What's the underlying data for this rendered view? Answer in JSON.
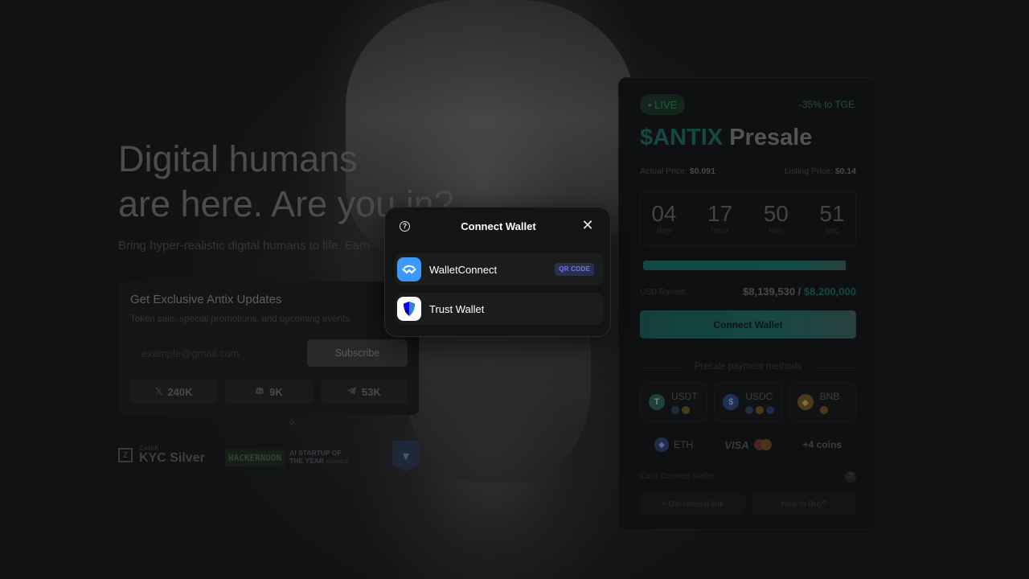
{
  "hero": {
    "title_line1": "Digital humans",
    "title_line2": "are here. Are you in?",
    "subtitle": "Bring hyper-realistic digital humans to life. Earn"
  },
  "updates": {
    "title": "Get Exclusive Antix Updates",
    "description": "Token sale, special promotions, and upcoming events",
    "email_placeholder": "example@gmail.com",
    "subscribe_label": "Subscribe",
    "socials": [
      {
        "icon": "x-icon",
        "count": "240K"
      },
      {
        "icon": "discord-icon",
        "count": "9K"
      },
      {
        "icon": "telegram-icon",
        "count": "53K"
      }
    ]
  },
  "badges": {
    "certik_small": "CertiK",
    "certik_big": "KYC Silver",
    "hackernoon_logo": "HACKERNOON",
    "hackernoon_line1": "AI STARTUP OF",
    "hackernoon_line2": "THE YEAR",
    "hackernoon_tag": "NOMINEE"
  },
  "presale": {
    "live_label": "• LIVE",
    "tge_label": "-35% to TGE",
    "token": "$ANTIX",
    "title_rest": "Presale",
    "actual_price_label": "Actual Price:",
    "actual_price": "$0.091",
    "listing_price_label": "Listing Price:",
    "listing_price": "$0.14",
    "countdown": [
      {
        "value": "04",
        "label": "day"
      },
      {
        "value": "17",
        "label": "hour"
      },
      {
        "value": "50",
        "label": "min"
      },
      {
        "value": "51",
        "label": "sec"
      }
    ],
    "progress_fraction": 0.993,
    "raised_label": "USD Raised:",
    "raised_value": "$8,139,530 /",
    "raised_target": "$8,200,000",
    "connect_label": "Connect Wallet",
    "methods_title": "Presale payment methods",
    "methods": [
      {
        "name": "USDT",
        "icon": "usdt-icon",
        "color": "#2b5e50"
      },
      {
        "name": "USDC",
        "icon": "usdc-icon",
        "color": "#2a4a7a"
      },
      {
        "name": "BNB",
        "icon": "bnb-icon",
        "color": "#6a5523"
      }
    ],
    "eth_label": "ETH",
    "visa_label": "VISA",
    "more_coins": "+4 coins",
    "cant_connect": "Can't Connect Wallet",
    "referral_label": "+ Get referral link",
    "how_to_buy": "How to Buy?"
  },
  "modal": {
    "title": "Connect Wallet",
    "wallets": [
      {
        "name": "WalletConnect",
        "badge": "QR CODE"
      },
      {
        "name": "Trust Wallet"
      }
    ]
  },
  "colors": {
    "accent_teal": "#1d6b63",
    "live_green": "#2f8a4b",
    "walletconnect_blue": "#3b99fc",
    "qr_badge": "#6d7de0"
  }
}
